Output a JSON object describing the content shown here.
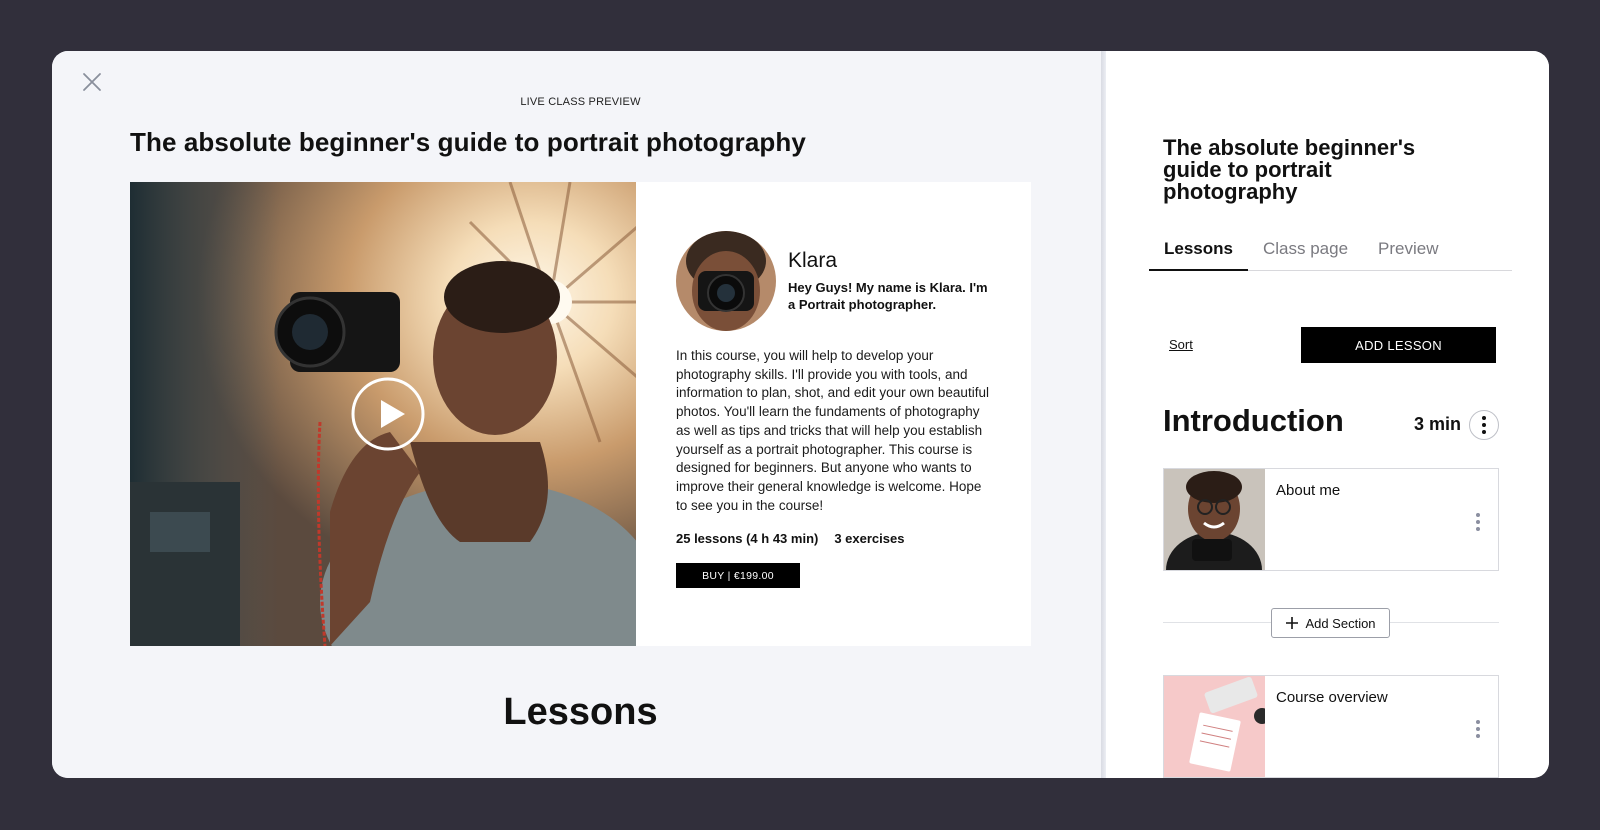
{
  "modal": {
    "close_icon": "close-icon"
  },
  "preview": {
    "eyebrow": "LIVE CLASS PREVIEW",
    "title": "The absolute beginner's guide to portrait photography",
    "play_icon": "play-icon",
    "instructor": {
      "name": "Klara",
      "tagline": "Hey Guys! My name is Klara. I'm a Portrait photographer."
    },
    "description": "In this course, you will help to develop your photography skills. I'll provide you with tools, and information to plan, shot, and edit your own beautiful photos. You'll learn the fundaments of photography as well as tips and tricks that will help you establish yourself as a portrait photographer. This course is designed for beginners. But anyone who wants to improve their general knowledge is welcome. Hope to see you in the course!",
    "stats": {
      "lessons": "25 lessons (4 h 43 min)",
      "exercises": "3 exercises"
    },
    "buy_label": "BUY | €199.00",
    "lessons_heading": "Lessons"
  },
  "panel": {
    "title": "The absolute beginner's guide to portrait photography",
    "tabs": [
      {
        "label": "Lessons",
        "active": true
      },
      {
        "label": "Class page",
        "active": false
      },
      {
        "label": "Preview",
        "active": false
      }
    ],
    "sort_label": "Sort",
    "add_lesson_label": "ADD LESSON",
    "section": {
      "title": "Introduction",
      "duration": "3 min"
    },
    "lessons": [
      {
        "title": "About me"
      },
      {
        "title": "Course overview"
      }
    ],
    "add_section_label": "Add Section"
  },
  "colors": {
    "backdrop": "#312f3b",
    "preview_bg": "#f4f5f9",
    "button_black": "#000000",
    "muted_tab": "#7a7a80"
  }
}
